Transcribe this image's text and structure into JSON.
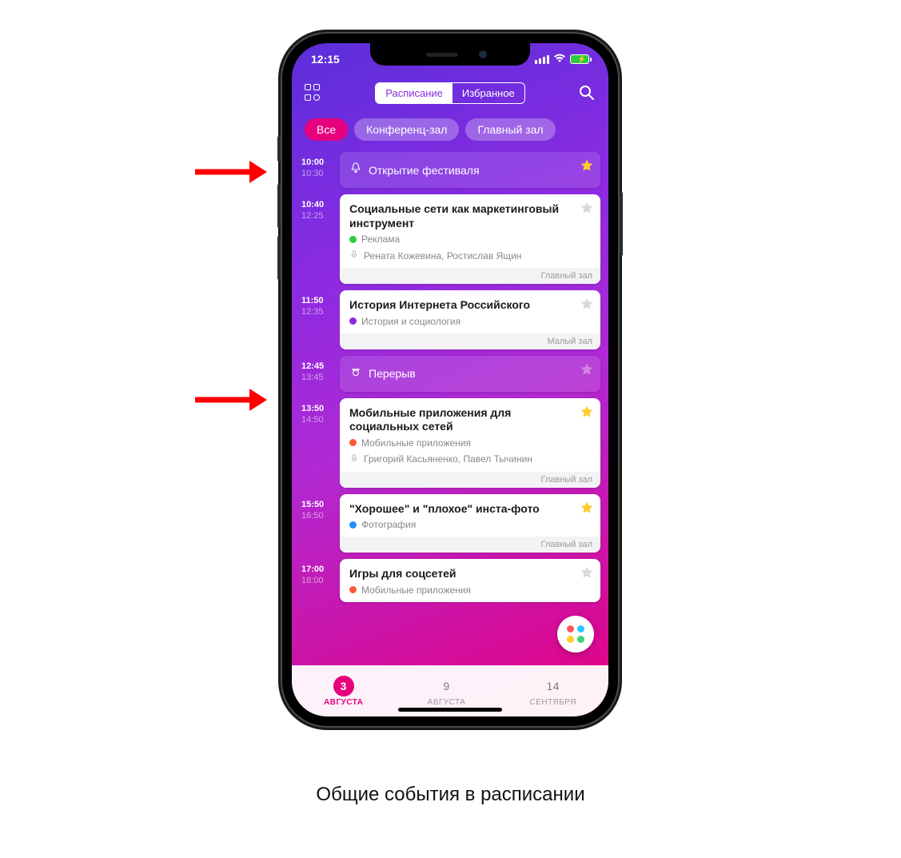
{
  "status": {
    "time": "12:15"
  },
  "nav": {
    "tabs": {
      "schedule": "Расписание",
      "favorites": "Избранное"
    }
  },
  "filters": [
    "Все",
    "Конференц-зал",
    "Главный зал"
  ],
  "events": [
    {
      "start": "10:00",
      "end": "10:30",
      "kind": "banner",
      "icon": "bell",
      "title": "Открытие фестиваля",
      "star": "gold"
    },
    {
      "start": "10:40",
      "end": "12:25",
      "kind": "session",
      "title": "Социальные сети как маркетинговый инструмент",
      "tag": {
        "color": "#2ecc40",
        "label": "Реклама"
      },
      "speakers": "Рената Кожевина, Ростислав Ящин",
      "room": "Главный зал",
      "star": "empty"
    },
    {
      "start": "11:50",
      "end": "12:35",
      "kind": "session",
      "title": "История Интернета Российского",
      "tag": {
        "color": "#8a2be2",
        "label": "История и социология"
      },
      "room": "Малый зал",
      "star": "empty"
    },
    {
      "start": "12:45",
      "end": "13:45",
      "kind": "banner",
      "icon": "meal",
      "title": "Перерыв",
      "star": "purple-empty"
    },
    {
      "start": "13:50",
      "end": "14:50",
      "kind": "session",
      "title": "Мобильные приложения для социальных сетей",
      "tag": {
        "color": "#ff5a36",
        "label": "Мобильные приложения"
      },
      "speakers": "Григорий Касьяненко, Павел Тычинин",
      "room": "Главный зал",
      "star": "gold"
    },
    {
      "start": "15:50",
      "end": "16:50",
      "kind": "session",
      "title": "\"Хорошее\" и \"плохое\" инста-фото",
      "tag": {
        "color": "#1e90ff",
        "label": "Фотография"
      },
      "room": "Главный зал",
      "star": "gold"
    },
    {
      "start": "17:00",
      "end": "18:00",
      "kind": "session",
      "title": "Игры для соцсетей",
      "tag": {
        "color": "#ff5a36",
        "label": "Мобильные приложения"
      },
      "room": "",
      "star": "empty"
    }
  ],
  "dates": [
    {
      "day": "3",
      "month": "АВГУСТА",
      "active": true
    },
    {
      "day": "9",
      "month": "АВГУСТА",
      "active": false
    },
    {
      "day": "14",
      "month": "СЕНТЯБРЯ",
      "active": false
    }
  ],
  "caption": "Общие события в расписании"
}
